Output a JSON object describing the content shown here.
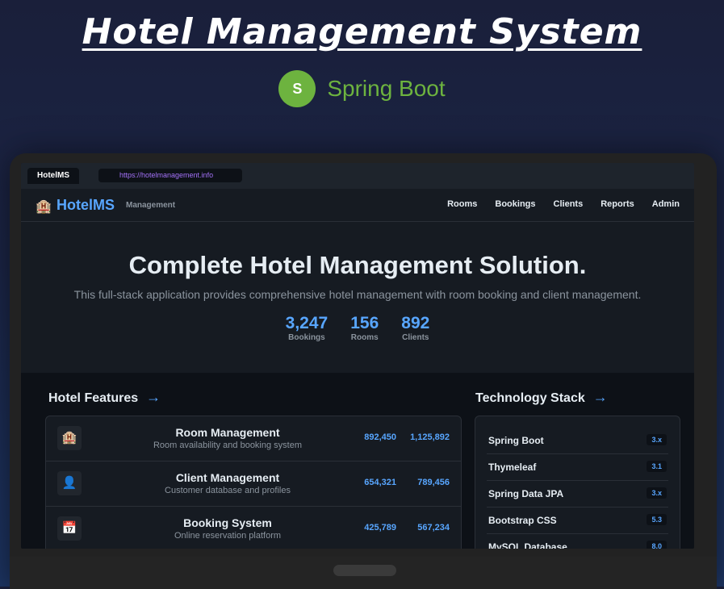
{
  "page": {
    "title": "Hotel Management System"
  },
  "badge": {
    "logo_letter": "S",
    "label": "Spring Boot",
    "color": "#6db33f"
  },
  "browser": {
    "tab": "HotelMS",
    "url": "https://hotelmanagement.info"
  },
  "nav": {
    "brand": "HotelMS",
    "brand_sub": "Management",
    "links": [
      "Rooms",
      "Bookings",
      "Clients",
      "Reports",
      "Admin"
    ]
  },
  "hero": {
    "title": "Complete Hotel Management Solution.",
    "subtitle": "This full-stack application provides comprehensive hotel management with room booking and client management.",
    "stats": [
      {
        "value": "3,247",
        "label": "Bookings"
      },
      {
        "value": "156",
        "label": "Rooms"
      },
      {
        "value": "892",
        "label": "Clients"
      }
    ]
  },
  "features": {
    "title": "Hotel Features",
    "arrow": "→",
    "items": [
      {
        "icon": "hotel-icon",
        "glyph": "🏨",
        "title": "Room Management",
        "desc": "Room availability and booking system",
        "v1": "892,450",
        "v2": "1,125,892"
      },
      {
        "icon": "client-icon",
        "glyph": "👤",
        "title": "Client Management",
        "desc": "Customer database and profiles",
        "v1": "654,321",
        "v2": "789,456"
      },
      {
        "icon": "calendar-icon",
        "glyph": "📅",
        "title": "Booking System",
        "desc": "Online reservation platform",
        "v1": "425,789",
        "v2": "567,234"
      }
    ]
  },
  "tech": {
    "title": "Technology Stack",
    "arrow": "→",
    "items": [
      {
        "name": "Spring Boot",
        "version": "3.x"
      },
      {
        "name": "Thymeleaf",
        "version": "3.1"
      },
      {
        "name": "Spring Data JPA",
        "version": "3.x"
      },
      {
        "name": "Bootstrap CSS",
        "version": "5.3"
      },
      {
        "name": "MySQL Database",
        "version": "8.0"
      }
    ]
  },
  "colors": {
    "accent": "#58a6ff",
    "spring_green": "#6db33f",
    "url_purple": "#a371f7"
  }
}
